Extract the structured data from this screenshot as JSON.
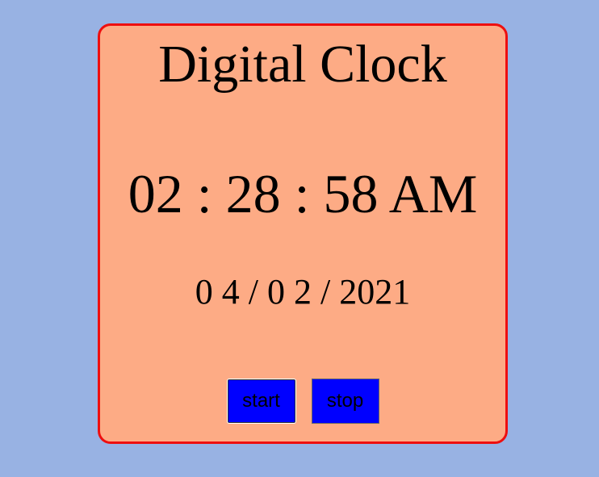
{
  "clock": {
    "title": "Digital Clock",
    "time": "02 : 28 : 58 AM",
    "date": "0 4 / 0 2 / 2021"
  },
  "controls": {
    "start_label": "start",
    "stop_label": "stop"
  },
  "colors": {
    "page_background": "#98b2e3",
    "card_background": "#fdab85",
    "card_border": "#ee0f0f",
    "button_background": "#0000ff"
  }
}
